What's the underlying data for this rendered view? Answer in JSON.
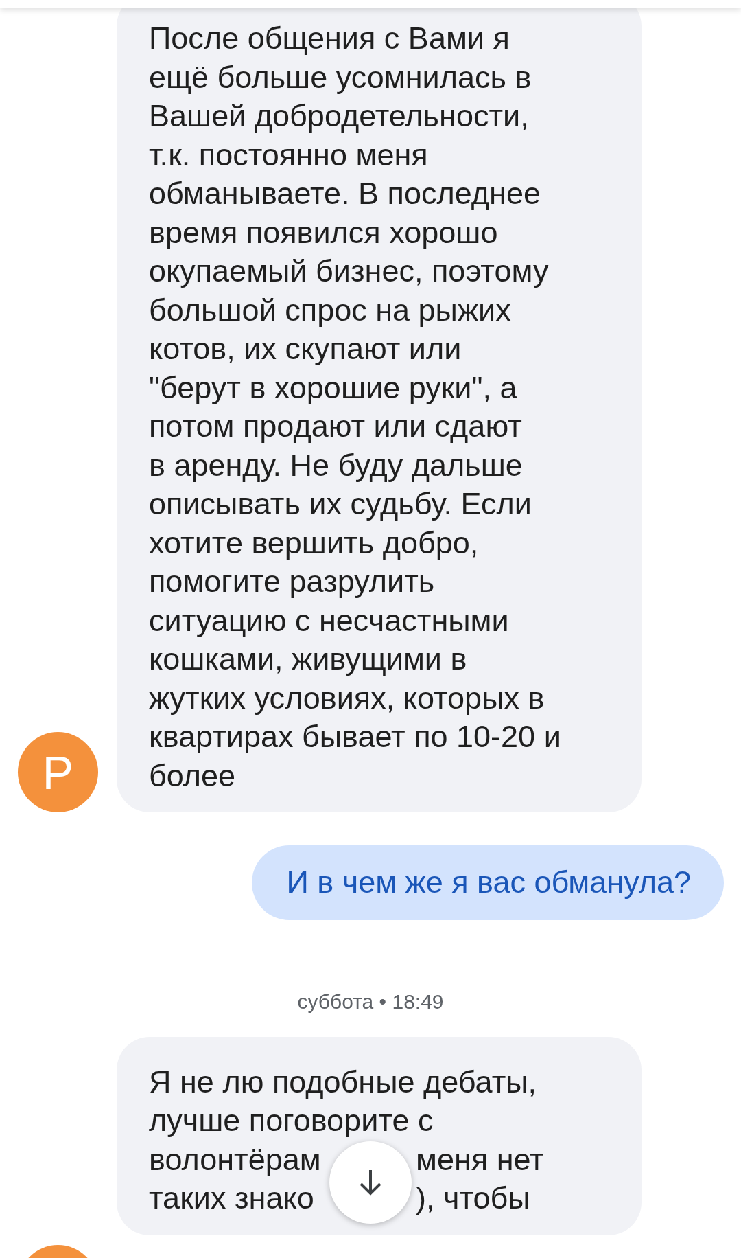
{
  "messages": [
    {
      "kind": "incoming",
      "avatar": {
        "letter": "Р"
      },
      "lines": [
        [
          "После общения с Вами я"
        ],
        [
          "ещё больше усомнилась в"
        ],
        [
          "Вашей добродетельности,"
        ],
        [
          "т.к. постоянно меня"
        ],
        [
          "обманываете. В последнее"
        ],
        [
          "время появился хорошо"
        ],
        [
          "окупаемый бизнес, поэтому"
        ],
        [
          "большой спрос на рыжих"
        ],
        [
          "котов, их скупают или"
        ],
        [
          "\"берут в хорошие руки\", а"
        ],
        [
          "потом продают или сдают"
        ],
        [
          "в аренду. Не буду дальше"
        ],
        [
          "описывать их судьбу. Если"
        ],
        [
          "хотите вершить добро,"
        ],
        [
          "помогите разрулить"
        ],
        [
          "ситуацию с несчастными"
        ],
        [
          "кошками, живущими в"
        ],
        [
          "жутких условиях, которых в"
        ],
        [
          "квартирах бывает по 10-20 и"
        ],
        [
          "более"
        ]
      ]
    },
    {
      "kind": "outgoing",
      "lines": [
        [
          "И в чем же я вас обманула?"
        ]
      ]
    },
    {
      "kind": "timestamp",
      "text": "суббота • 18:49"
    },
    {
      "kind": "incoming",
      "lines": [
        [
          "Я не лю подобные дебаты,"
        ],
        [
          "лучше поговорите с"
        ],
        [
          "волонтёрам",
          "меня нет"
        ],
        [
          "таких знако",
          "), чтобы"
        ]
      ]
    }
  ]
}
